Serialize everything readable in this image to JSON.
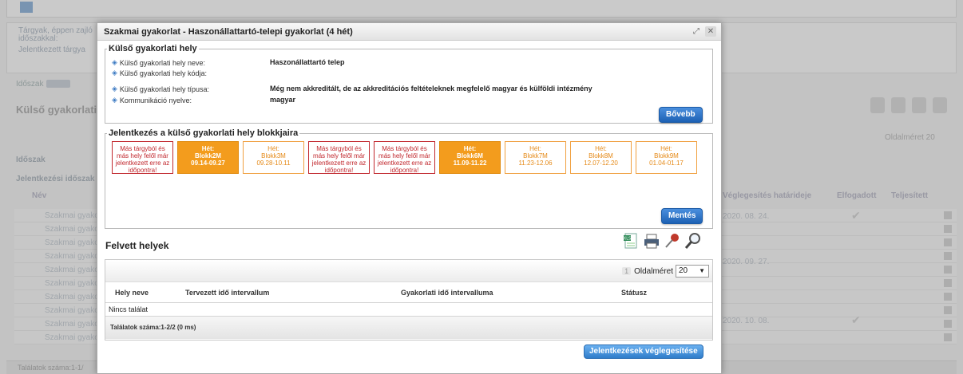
{
  "modal": {
    "title": "Szakmai gyakorlat - Haszonállattartó-telepi gyakorlat (4 hét)",
    "external_site": {
      "legend": "Külső gyakorlati hely",
      "fields": [
        {
          "label": "Külső gyakorlati hely neve:",
          "value": "Haszonállattartó telep"
        },
        {
          "label": "Külső gyakorlati hely kódja:",
          "value": ""
        },
        {
          "label": "Külső gyakorlati hely típusa:",
          "value": "Még nem akkreditált, de az akkreditációs feltételeknek megfelelő magyar és külföldi intézmény"
        },
        {
          "label": "Kommunikáció nyelve:",
          "value": "magyar"
        }
      ],
      "more_button": "Bővebb"
    },
    "registration": {
      "legend": "Jelentkezés a külső gyakorlati hely blokkjaira",
      "blocks": [
        {
          "state": "taken",
          "line1": "Más tárgyból és",
          "line2": "más hely felől már",
          "line3": "jelentkezett erre az",
          "line4": "időpontra!"
        },
        {
          "state": "selected",
          "line1": "Hét:",
          "line2": "Blokk2M",
          "line3": "09.14-09.27",
          "line4": ""
        },
        {
          "state": "free",
          "line1": "Hét:",
          "line2": "Blokk3M",
          "line3": "09.28-10.11",
          "line4": ""
        },
        {
          "state": "taken",
          "line1": "Más tárgyból és",
          "line2": "más hely felől már",
          "line3": "jelentkezett erre az",
          "line4": "időpontra!"
        },
        {
          "state": "taken",
          "line1": "Más tárgyból és",
          "line2": "más hely felől már",
          "line3": "jelentkezett erre az",
          "line4": "időpontra!"
        },
        {
          "state": "selected",
          "line1": "Hét:",
          "line2": "Blokk6M",
          "line3": "11.09-11.22",
          "line4": ""
        },
        {
          "state": "free",
          "line1": "Hét:",
          "line2": "Blokk7M",
          "line3": "11.23-12.06",
          "line4": ""
        },
        {
          "state": "free",
          "line1": "Hét:",
          "line2": "Blokk8M",
          "line3": "12.07-12.20",
          "line4": ""
        },
        {
          "state": "free",
          "line1": "Hét:",
          "line2": "Blokk9M",
          "line3": "01.04-01.17",
          "line4": ""
        }
      ],
      "save_button": "Mentés"
    },
    "taken_places": {
      "title": "Felvett helyek",
      "toolbar_icons": [
        "excel-export-icon",
        "print-icon",
        "pin-icon",
        "search-icon"
      ],
      "pager": {
        "page": "1",
        "page_size_label": "Oldalméret",
        "page_size": "20"
      },
      "columns": [
        "Hely neve",
        "Tervezett idő intervallum",
        "Gyakorlati idő intervalluma",
        "Státusz"
      ],
      "empty_text": "Nincs találat",
      "footer": "Találatok száma:1-2/2 (0 ms)"
    },
    "finalize_button": "Jelentkezések véglegesítése"
  },
  "background": {
    "hint_lines": [
      "Tárgyak, éppen zajló",
      "időszakkal:",
      "Jelentkezett tárgya"
    ],
    "filter_label": "Időszak",
    "section_title": "Külső gyakorlati tár",
    "page_size_text": "Oldalméret 20",
    "groups": [
      "Időszak",
      "Jelentkezési időszak"
    ],
    "col_name": "Név",
    "col_deadline": "Véglegesítés határideje",
    "col_accepted": "Elfogadott",
    "col_done": "Teljesített",
    "row_text": "Szakmai gyakorlat",
    "dates": [
      "2020. 08. 24.",
      "2020. 09. 27.",
      "2020. 10. 08."
    ],
    "footer": "Találatok száma:1-1/"
  }
}
